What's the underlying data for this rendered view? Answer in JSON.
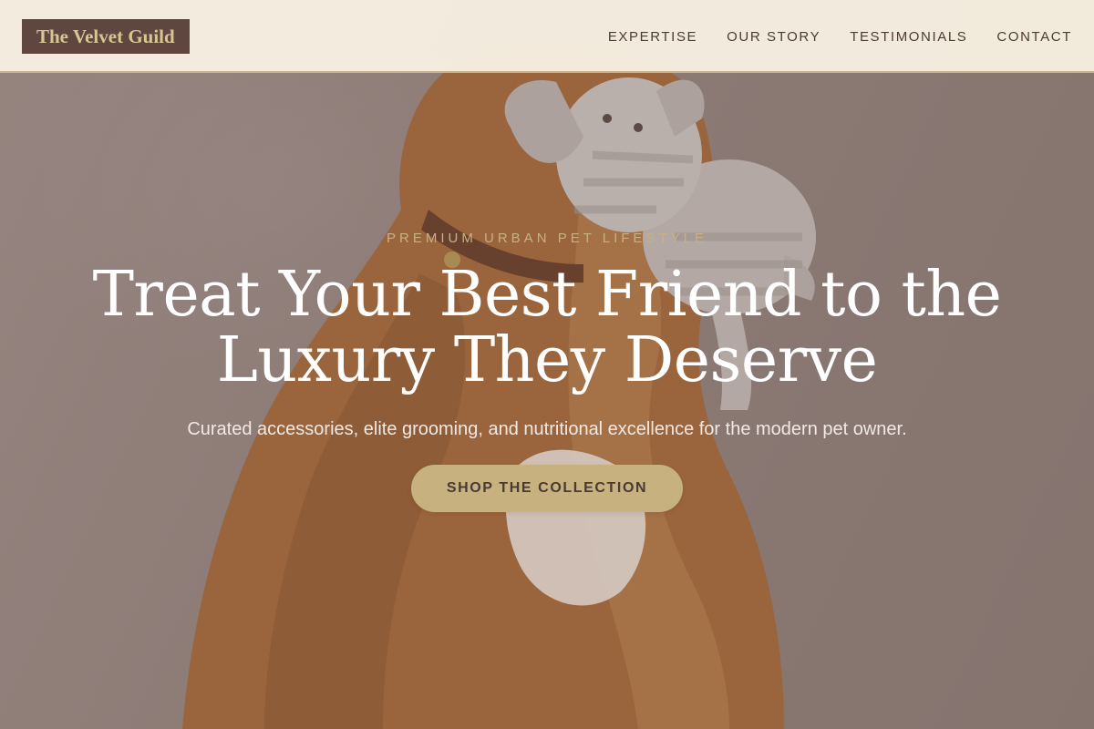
{
  "brand": {
    "name": "The Velvet Guild",
    "colors": {
      "primary_dark": "#5f463e",
      "gold": "#c6b17f",
      "cream": "#f6eee0",
      "eyebrow": "#c7b184"
    }
  },
  "nav": {
    "items": [
      {
        "label": "EXPERTISE"
      },
      {
        "label": "OUR STORY"
      },
      {
        "label": "TESTIMONIALS"
      },
      {
        "label": "CONTACT"
      }
    ]
  },
  "hero": {
    "eyebrow": "PREMIUM URBAN PET LIFESTYLE",
    "headline": "Treat Your Best Friend to the Luxury They Deserve",
    "subheadline": "Curated accessories, elite grooming, and nutritional excellence for the modern pet owner.",
    "cta_label": "SHOP THE COLLECTION",
    "background_image": "dog-with-plush-elephant-toy"
  }
}
